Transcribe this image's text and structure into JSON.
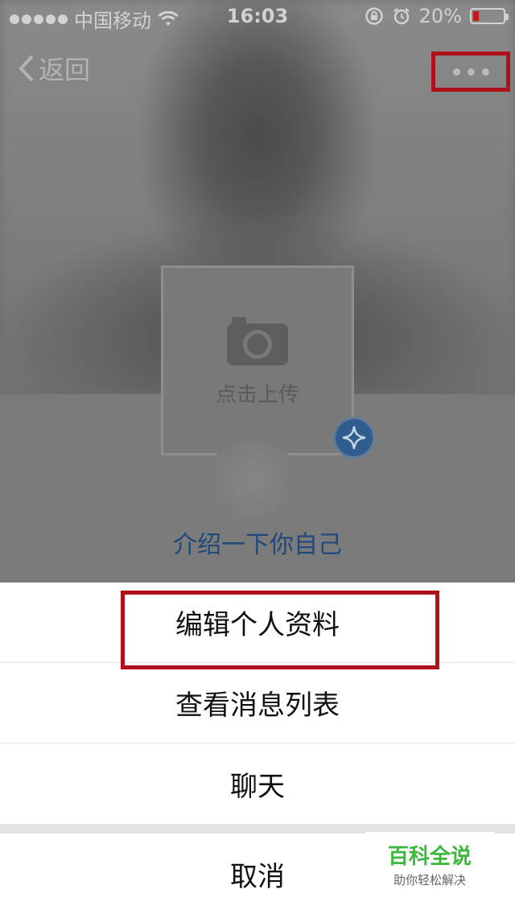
{
  "status_bar": {
    "carrier": "中国移动",
    "time": "16:03",
    "battery_percent": "20%",
    "battery_level": 0.2,
    "icons": [
      "signal-dots-icon",
      "wifi-icon",
      "rotation-lock-icon",
      "alarm-icon",
      "battery-icon"
    ]
  },
  "nav": {
    "back_label": "返回",
    "more_icon": "more-dots-icon"
  },
  "profile": {
    "upload_label": "点击上传",
    "intro_link": "介绍一下你自己",
    "upload_icon": "camera-icon",
    "badge_icon": "star-badge-icon"
  },
  "action_sheet": {
    "items": [
      {
        "label": "编辑个人资料"
      },
      {
        "label": "查看消息列表"
      },
      {
        "label": "聊天"
      }
    ],
    "cancel_label": "取消"
  },
  "watermark": {
    "title": "百科全说",
    "subtitle": "助你轻松解决"
  },
  "colors": {
    "highlight_red": "#b0101a",
    "link_blue": "#1d4a7b",
    "sheet_bg": "#ffffff",
    "watermark_green": "#3cb83c"
  }
}
